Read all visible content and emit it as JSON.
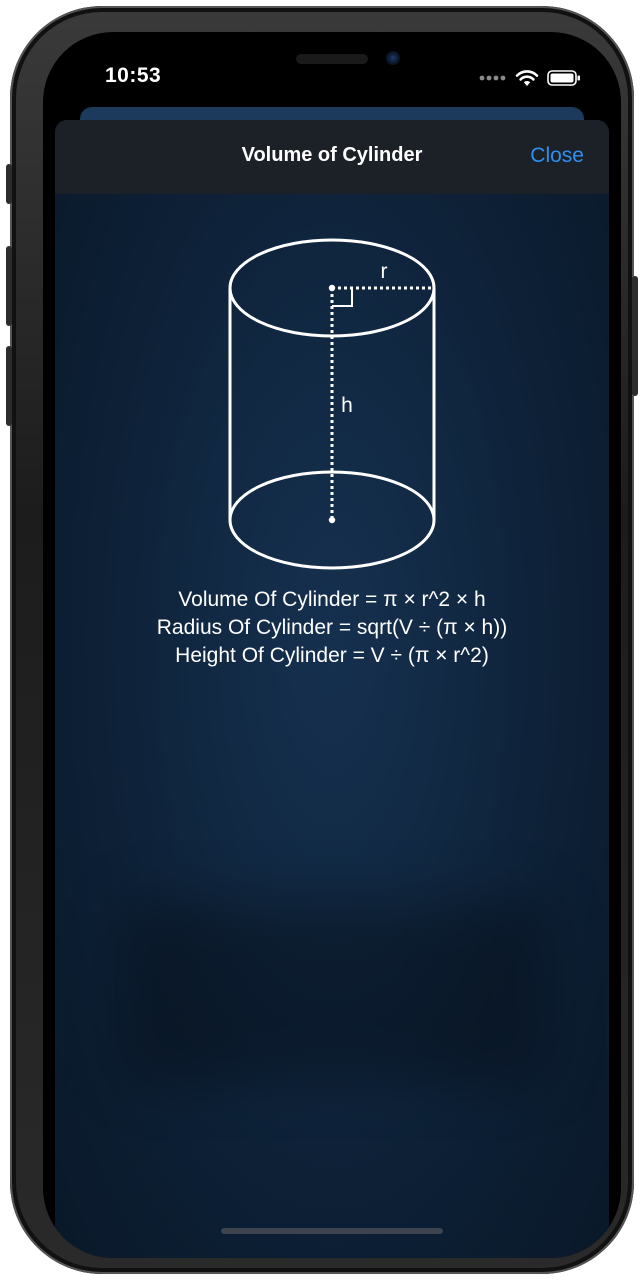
{
  "status_bar": {
    "time": "10:53",
    "icons": [
      "signal-dots-icon",
      "wifi-icon",
      "battery-icon"
    ]
  },
  "sheet": {
    "title": "Volume of Cylinder",
    "close_label": "Close",
    "accent_color": "#2f8ff0"
  },
  "diagram": {
    "radius_label": "r",
    "height_label": "h"
  },
  "formulas": [
    "Volume Of Cylinder = π × r^2 × h",
    "Radius Of Cylinder = sqrt(V ÷ (π × h))",
    "Height Of Cylinder = V ÷ (π × r^2)"
  ]
}
